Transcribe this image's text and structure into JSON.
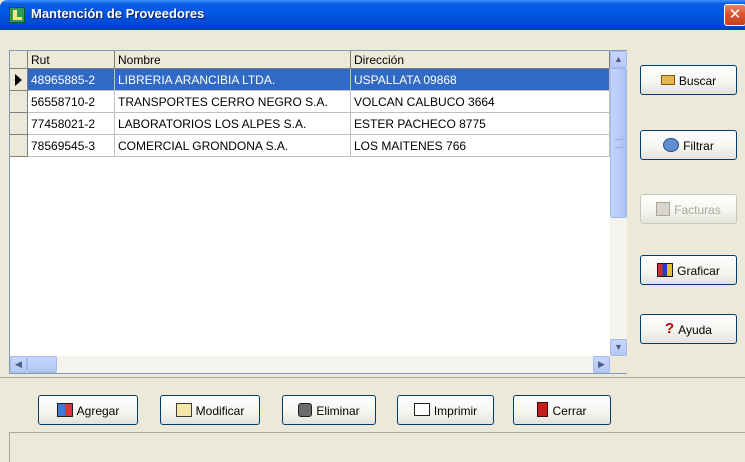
{
  "window": {
    "title": "Mantención de Proveedores",
    "close_glyph": "✕"
  },
  "grid": {
    "columns": [
      "Rut",
      "Nombre",
      "Dirección"
    ],
    "rows": [
      {
        "rut": "48965885-2",
        "nombre": "LIBRERIA ARANCIBIA LTDA.",
        "direccion": "USPALLATA 09868"
      },
      {
        "rut": "56558710-2",
        "nombre": "TRANSPORTES CERRO NEGRO S.A.",
        "direccion": "VOLCAN CALBUCO 3664"
      },
      {
        "rut": "77458021-2",
        "nombre": "LABORATORIOS LOS ALPES S.A.",
        "direccion": "ESTER PACHECO 8775"
      },
      {
        "rut": "78569545-3",
        "nombre": "COMERCIAL GRONDONA S.A.",
        "direccion": "LOS MAITENES 766"
      }
    ],
    "selected_row": 0
  },
  "side_buttons": {
    "buscar": "Buscar",
    "filtrar": "Filtrar",
    "facturas": "Facturas",
    "graficar": "Graficar",
    "ayuda": "Ayuda"
  },
  "bottom_buttons": {
    "agregar": "Agregar",
    "modificar": "Modificar",
    "eliminar": "Eliminar",
    "imprimir": "Imprimir",
    "cerrar": "Cerrar"
  },
  "colors": {
    "titlebar": "#0055e5",
    "selection": "#316ac5",
    "background": "#ece9d8"
  }
}
